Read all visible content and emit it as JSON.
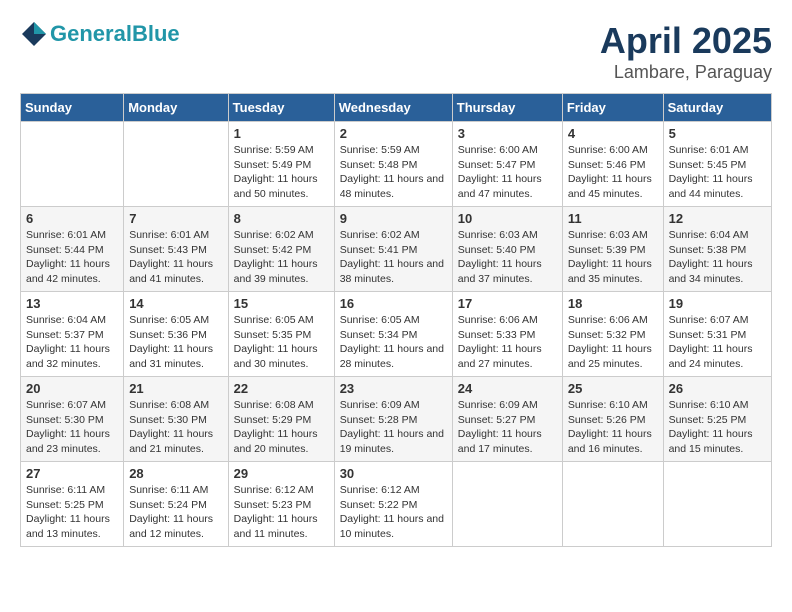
{
  "header": {
    "logo_line1": "General",
    "logo_line2": "Blue",
    "title": "April 2025",
    "subtitle": "Lambare, Paraguay"
  },
  "calendar": {
    "weekdays": [
      "Sunday",
      "Monday",
      "Tuesday",
      "Wednesday",
      "Thursday",
      "Friday",
      "Saturday"
    ],
    "weeks": [
      [
        {
          "day": "",
          "info": ""
        },
        {
          "day": "",
          "info": ""
        },
        {
          "day": "1",
          "info": "Sunrise: 5:59 AM\nSunset: 5:49 PM\nDaylight: 11 hours and 50 minutes."
        },
        {
          "day": "2",
          "info": "Sunrise: 5:59 AM\nSunset: 5:48 PM\nDaylight: 11 hours and 48 minutes."
        },
        {
          "day": "3",
          "info": "Sunrise: 6:00 AM\nSunset: 5:47 PM\nDaylight: 11 hours and 47 minutes."
        },
        {
          "day": "4",
          "info": "Sunrise: 6:00 AM\nSunset: 5:46 PM\nDaylight: 11 hours and 45 minutes."
        },
        {
          "day": "5",
          "info": "Sunrise: 6:01 AM\nSunset: 5:45 PM\nDaylight: 11 hours and 44 minutes."
        }
      ],
      [
        {
          "day": "6",
          "info": "Sunrise: 6:01 AM\nSunset: 5:44 PM\nDaylight: 11 hours and 42 minutes."
        },
        {
          "day": "7",
          "info": "Sunrise: 6:01 AM\nSunset: 5:43 PM\nDaylight: 11 hours and 41 minutes."
        },
        {
          "day": "8",
          "info": "Sunrise: 6:02 AM\nSunset: 5:42 PM\nDaylight: 11 hours and 39 minutes."
        },
        {
          "day": "9",
          "info": "Sunrise: 6:02 AM\nSunset: 5:41 PM\nDaylight: 11 hours and 38 minutes."
        },
        {
          "day": "10",
          "info": "Sunrise: 6:03 AM\nSunset: 5:40 PM\nDaylight: 11 hours and 37 minutes."
        },
        {
          "day": "11",
          "info": "Sunrise: 6:03 AM\nSunset: 5:39 PM\nDaylight: 11 hours and 35 minutes."
        },
        {
          "day": "12",
          "info": "Sunrise: 6:04 AM\nSunset: 5:38 PM\nDaylight: 11 hours and 34 minutes."
        }
      ],
      [
        {
          "day": "13",
          "info": "Sunrise: 6:04 AM\nSunset: 5:37 PM\nDaylight: 11 hours and 32 minutes."
        },
        {
          "day": "14",
          "info": "Sunrise: 6:05 AM\nSunset: 5:36 PM\nDaylight: 11 hours and 31 minutes."
        },
        {
          "day": "15",
          "info": "Sunrise: 6:05 AM\nSunset: 5:35 PM\nDaylight: 11 hours and 30 minutes."
        },
        {
          "day": "16",
          "info": "Sunrise: 6:05 AM\nSunset: 5:34 PM\nDaylight: 11 hours and 28 minutes."
        },
        {
          "day": "17",
          "info": "Sunrise: 6:06 AM\nSunset: 5:33 PM\nDaylight: 11 hours and 27 minutes."
        },
        {
          "day": "18",
          "info": "Sunrise: 6:06 AM\nSunset: 5:32 PM\nDaylight: 11 hours and 25 minutes."
        },
        {
          "day": "19",
          "info": "Sunrise: 6:07 AM\nSunset: 5:31 PM\nDaylight: 11 hours and 24 minutes."
        }
      ],
      [
        {
          "day": "20",
          "info": "Sunrise: 6:07 AM\nSunset: 5:30 PM\nDaylight: 11 hours and 23 minutes."
        },
        {
          "day": "21",
          "info": "Sunrise: 6:08 AM\nSunset: 5:30 PM\nDaylight: 11 hours and 21 minutes."
        },
        {
          "day": "22",
          "info": "Sunrise: 6:08 AM\nSunset: 5:29 PM\nDaylight: 11 hours and 20 minutes."
        },
        {
          "day": "23",
          "info": "Sunrise: 6:09 AM\nSunset: 5:28 PM\nDaylight: 11 hours and 19 minutes."
        },
        {
          "day": "24",
          "info": "Sunrise: 6:09 AM\nSunset: 5:27 PM\nDaylight: 11 hours and 17 minutes."
        },
        {
          "day": "25",
          "info": "Sunrise: 6:10 AM\nSunset: 5:26 PM\nDaylight: 11 hours and 16 minutes."
        },
        {
          "day": "26",
          "info": "Sunrise: 6:10 AM\nSunset: 5:25 PM\nDaylight: 11 hours and 15 minutes."
        }
      ],
      [
        {
          "day": "27",
          "info": "Sunrise: 6:11 AM\nSunset: 5:25 PM\nDaylight: 11 hours and 13 minutes."
        },
        {
          "day": "28",
          "info": "Sunrise: 6:11 AM\nSunset: 5:24 PM\nDaylight: 11 hours and 12 minutes."
        },
        {
          "day": "29",
          "info": "Sunrise: 6:12 AM\nSunset: 5:23 PM\nDaylight: 11 hours and 11 minutes."
        },
        {
          "day": "30",
          "info": "Sunrise: 6:12 AM\nSunset: 5:22 PM\nDaylight: 11 hours and 10 minutes."
        },
        {
          "day": "",
          "info": ""
        },
        {
          "day": "",
          "info": ""
        },
        {
          "day": "",
          "info": ""
        }
      ]
    ]
  }
}
